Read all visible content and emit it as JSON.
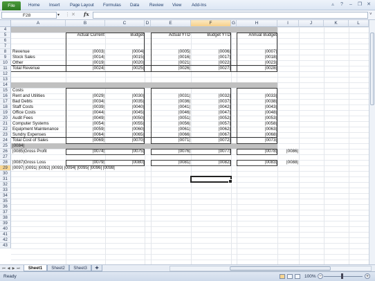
{
  "ribbon": {
    "file": "File",
    "tabs": [
      "Home",
      "Insert",
      "Page Layout",
      "Formulas",
      "Data",
      "Review",
      "View",
      "Add-Ins"
    ]
  },
  "formula_bar": {
    "name_box": "F28",
    "fx": "fx",
    "content": ""
  },
  "columns": [
    "A",
    "B",
    "C",
    "D",
    "E",
    "F",
    "G",
    "H",
    "I",
    "J",
    "K",
    "L"
  ],
  "rows": [
    "4",
    "5",
    "6",
    "7",
    "8",
    "9",
    "10",
    "11",
    "12",
    "13",
    "14",
    "15",
    "16",
    "17",
    "18",
    "19",
    "20",
    "21",
    "22",
    "23",
    "24",
    "25",
    "26",
    "27",
    "28",
    "29",
    "30",
    "31",
    "32",
    "33",
    "34",
    "35",
    "36",
    "37",
    "38",
    "39",
    "40",
    "41",
    "42",
    "43"
  ],
  "headers": {
    "actual_current": "Actual Current",
    "budget": "Budget",
    "actual_ytd": "Actual YTD",
    "budget_ytd": "Budget YTD",
    "annual_budget": "Annual Budget"
  },
  "revenue": {
    "labels": [
      "Revenue",
      "Stock Sales",
      "Other",
      "Total Revenue"
    ],
    "ac": [
      "|0003|",
      "|0014|",
      "|0019|",
      "|0024|"
    ],
    "bu": [
      "|0004|",
      "|0015|",
      "|0020|",
      "|0025|"
    ],
    "ay": [
      "|0005|",
      "|0016|",
      "|0021|",
      "|0026|"
    ],
    "by": [
      "|0006|",
      "|0017|",
      "|0022|",
      "|0027|"
    ],
    "an": [
      "|0007|",
      "|0018|",
      "|0023|",
      "|0028|"
    ]
  },
  "costs": {
    "title": "Costs",
    "labels": [
      "Rent and Utilities",
      "Bad Debts",
      "Staff Costs",
      "Office Costs",
      "Audit Fees",
      "Computer Systems",
      "Equipment Maintenance",
      "Sundry Expenses",
      "Total Cost of Sales"
    ],
    "ac": [
      "|0029|",
      "|0034|",
      "|0039|",
      "|0044|",
      "|0049|",
      "|0054|",
      "|0059|",
      "|0064|",
      "|0069|"
    ],
    "bu": [
      "|0030|",
      "|0035|",
      "|0040|",
      "|0045|",
      "|0050|",
      "|0055|",
      "|0060|",
      "|0065|",
      "|0070|"
    ],
    "ay": [
      "|0031|",
      "|0036|",
      "|0041|",
      "|0046|",
      "|0051|",
      "|0056|",
      "|0061|",
      "|0066|",
      "|0071|"
    ],
    "by": [
      "|0032|",
      "|0037|",
      "|0042|",
      "|0047|",
      "|0052|",
      "|0057|",
      "|0062|",
      "|0067|",
      "|0072|"
    ],
    "an": [
      "|0033|",
      "|0038|",
      "|0043|",
      "|0048|",
      "|0053|",
      "|0058|",
      "|0063|",
      "|0068|",
      "|0073|"
    ]
  },
  "row22": "|0084|",
  "gross_profit": {
    "label": "|0085|Gross Profit",
    "ac": "|0074|",
    "bu": "|0075|",
    "ay": "|0076|",
    "by": "|0077|",
    "an": "|0078|",
    "extra": "|0086|"
  },
  "gross_loss": {
    "label": "|0087|Gross Loss",
    "ac": "|0079|",
    "bu": "|0080|",
    "ay": "|0081|",
    "by": "|0082|",
    "an": "|0083|",
    "extra": "|0088|"
  },
  "row26": "|0097| |0091| |0092| |0093| |0094| |0095| |0096| |0098|",
  "sheets": [
    "Sheet1",
    "Sheet2",
    "Sheet3"
  ],
  "status": {
    "ready": "Ready",
    "zoom": "100%"
  }
}
